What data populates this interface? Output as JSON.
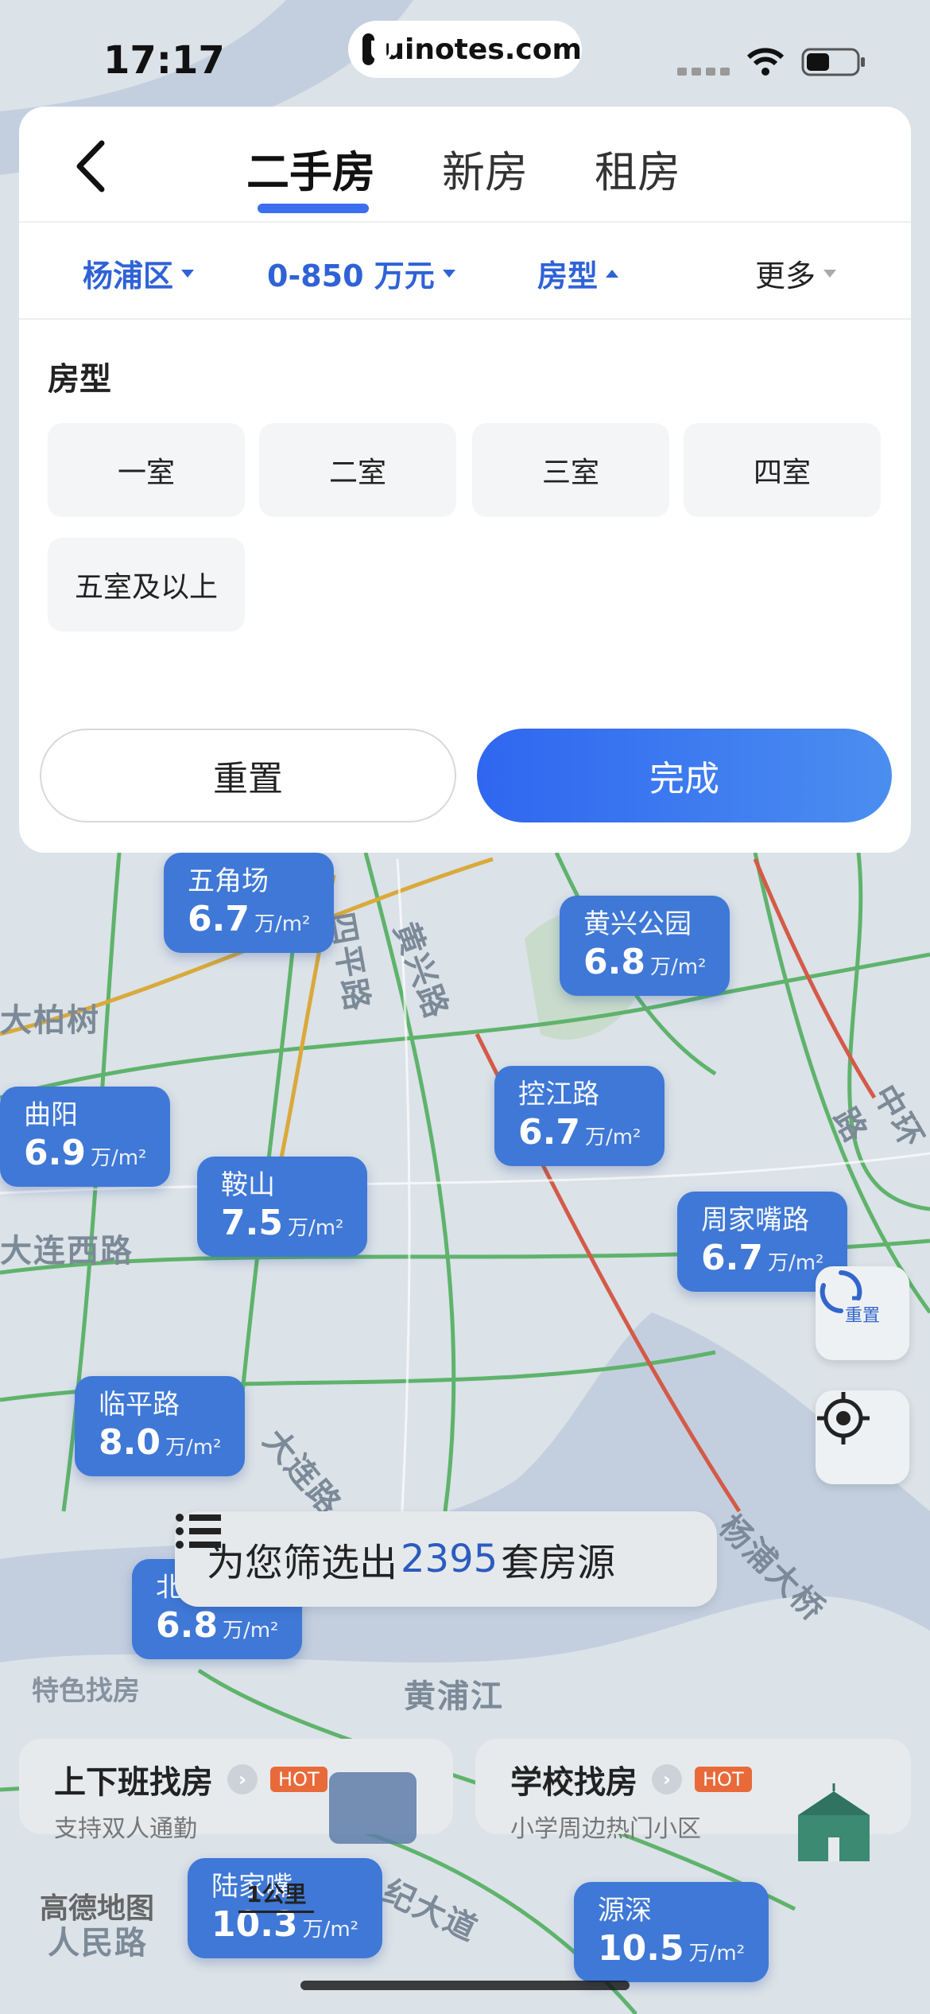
{
  "status_bar": {
    "time": "17:17",
    "url": "uinotes.com"
  },
  "nav": {
    "tabs": [
      {
        "label": "二手房",
        "active": true
      },
      {
        "label": "新房",
        "active": false
      },
      {
        "label": "租房",
        "active": false
      }
    ]
  },
  "filters": [
    {
      "label": "杨浦区",
      "active": true
    },
    {
      "label": "0-850 万元",
      "active": true
    },
    {
      "label": "房型",
      "active": true
    },
    {
      "label": "更多",
      "active": false
    }
  ],
  "room_section": {
    "title": "房型",
    "options": [
      "一室",
      "二室",
      "三室",
      "四室",
      "五室及以上"
    ]
  },
  "actions": {
    "reset": "重置",
    "done": "完成"
  },
  "map": {
    "streets": [
      "四平路",
      "黄兴路",
      "大柏树",
      "大连西路",
      "中环路",
      "大连路",
      "杨浦大桥",
      "黄浦江",
      "纪大道",
      "人民路"
    ],
    "bubbles": [
      {
        "name": "五角场",
        "price": "6.7",
        "unit": "万/m²"
      },
      {
        "name": "黄兴公园",
        "price": "6.8",
        "unit": "万/m²"
      },
      {
        "name": "曲阳",
        "price": "6.9",
        "unit": "万/m²"
      },
      {
        "name": "控江路",
        "price": "6.7",
        "unit": "万/m²"
      },
      {
        "name": "鞍山",
        "price": "7.5",
        "unit": "万/m²"
      },
      {
        "name": "周家嘴路",
        "price": "6.7",
        "unit": "万/m²"
      },
      {
        "name": "临平路",
        "price": "8.0",
        "unit": "万/m²"
      },
      {
        "name": "北",
        "price": "6.8",
        "unit": "万/m²"
      },
      {
        "name": "陆家嘴",
        "price": "10.3",
        "unit": "万/m²"
      },
      {
        "name": "源深",
        "price": "10.5",
        "unit": "万/m²"
      }
    ],
    "refresh_label": "重置",
    "result_prefix": "为您筛选出",
    "result_count": "2395",
    "result_suffix": "套房源",
    "feature_title": "特色找房",
    "features": [
      {
        "title": "上下班找房",
        "badge": "HOT",
        "subtitle": "支持双人通勤"
      },
      {
        "title": "学校找房",
        "badge": "HOT",
        "subtitle": "小学周边热门小区"
      }
    ],
    "scale": "1公里",
    "provider": "高德地图"
  },
  "colors": {
    "accent": "#3c6ff0",
    "bubble": "#3f78d6",
    "hot": "#e86a3a"
  }
}
